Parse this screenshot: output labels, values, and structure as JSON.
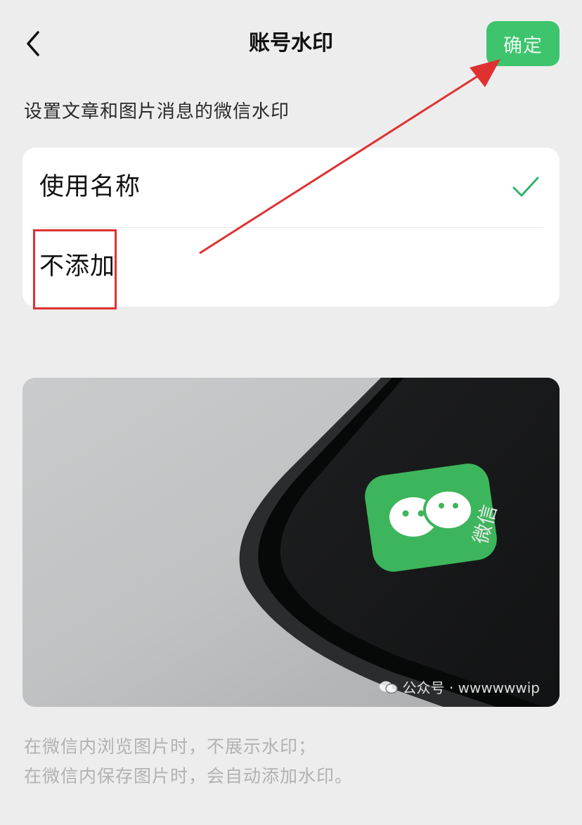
{
  "header": {
    "back_icon": "chevron-left-icon",
    "title": "账号水印",
    "confirm_label": "确定"
  },
  "section_description": "设置文章和图片消息的微信水印",
  "options": [
    {
      "label": "使用名称",
      "selected": true
    },
    {
      "label": "不添加",
      "selected": false
    }
  ],
  "preview": {
    "app_icon_label": "微信",
    "watermark_text": "公众号 · wwwwwwip"
  },
  "footnote": {
    "line1": "在微信内浏览图片时，不展示水印；",
    "line2": "在微信内保存图片时，会自动添加水印。"
  },
  "colors": {
    "accent": "#3ec46d",
    "check": "#07c160",
    "annotation": "#e03131",
    "background": "#ededed"
  }
}
